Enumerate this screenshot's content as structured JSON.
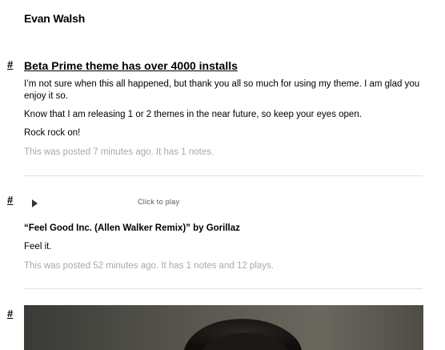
{
  "blog": {
    "title": "Evan Walsh"
  },
  "posts": [
    {
      "type": "text",
      "permalink": "#",
      "title": "Beta Prime theme has over 4000 installs",
      "paragraphs": [
        "I’m not sure when this all happened, but thank you all so much for using my theme. I am glad you enjoy it so.",
        "Know that I am releasing 1 or 2 themes in the near future, so keep your eyes open.",
        "Rock rock on!"
      ],
      "meta": "This was posted 7 minutes ago. It has 1 notes."
    },
    {
      "type": "audio",
      "permalink": "#",
      "player_label": "Click to play",
      "title": "“Feel Good Inc. (Allen Walker Remix)” by Gorillaz",
      "caption": "Feel it.",
      "meta": "This was posted 52 minutes ago. It has 1 notes and 12 plays."
    },
    {
      "type": "photo",
      "permalink": "#"
    }
  ],
  "colors": {
    "meta_text": "#a9a9a9",
    "divider": "#e2e2e2",
    "photo_bg": "#4b4943"
  },
  "icons": {
    "play": "play-icon"
  }
}
